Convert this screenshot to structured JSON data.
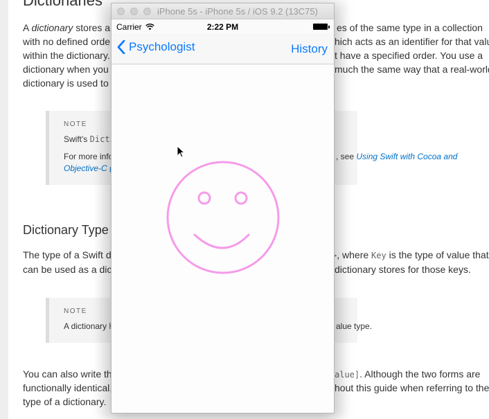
{
  "document": {
    "heading_partial": "Dictionaries",
    "intro_lines": [
      {
        "a": "A ",
        "em": "dictionary",
        "b": " stores a",
        "right": "es of the same type in a collection"
      },
      {
        "a": "with no defined order",
        "right": "hich acts as an identifier for that value"
      },
      {
        "a": "within the dictionary.",
        "right": "t have a specified order. You use a"
      },
      {
        "a": "dictionary when you",
        "right": "much the same way that a real-world"
      },
      {
        "a": "dictionary is used to"
      }
    ],
    "note1": {
      "label": "NOTE",
      "line1_a": "Swift's ",
      "line1_code": "Dictic",
      "line2_a": "For more infor",
      "line2_b": ", see ",
      "line2_link": "Using Swift with Cocoa and",
      "line3_link": "Objective-C (S"
    },
    "section_heading": "Dictionary Type",
    "type_lines": {
      "l1_a": "The type of a Swift d",
      "l1_code1": ">",
      "l1_b": ", where ",
      "l1_code2": "Key",
      "l1_c": " is the type of value that",
      "l2_a": "can be used as a dic",
      "l2_b": "dictionary stores for those keys."
    },
    "note2": {
      "label": "NOTE",
      "text_a": "A dictionary ",
      "text_code": "K",
      "text_b": "alue type."
    },
    "closing_lines": {
      "l1_a": "You can also write th",
      "l1_code": "alue]",
      "l1_b": ". Although the two forms are",
      "l2_a": "functionally identical,",
      "l2_b": "hout this guide when referring to the",
      "l3": "type of a dictionary."
    }
  },
  "simulator": {
    "window_title": "iPhone 5s - iPhone 5s / iOS 9.2 (13C75)",
    "status_bar": {
      "carrier": "Carrier",
      "time": "2:22 PM"
    },
    "nav": {
      "back_label": "Psychologist",
      "right_label": "History"
    },
    "colors": {
      "tint": "#0a7aff",
      "face": "#f59be9"
    }
  }
}
